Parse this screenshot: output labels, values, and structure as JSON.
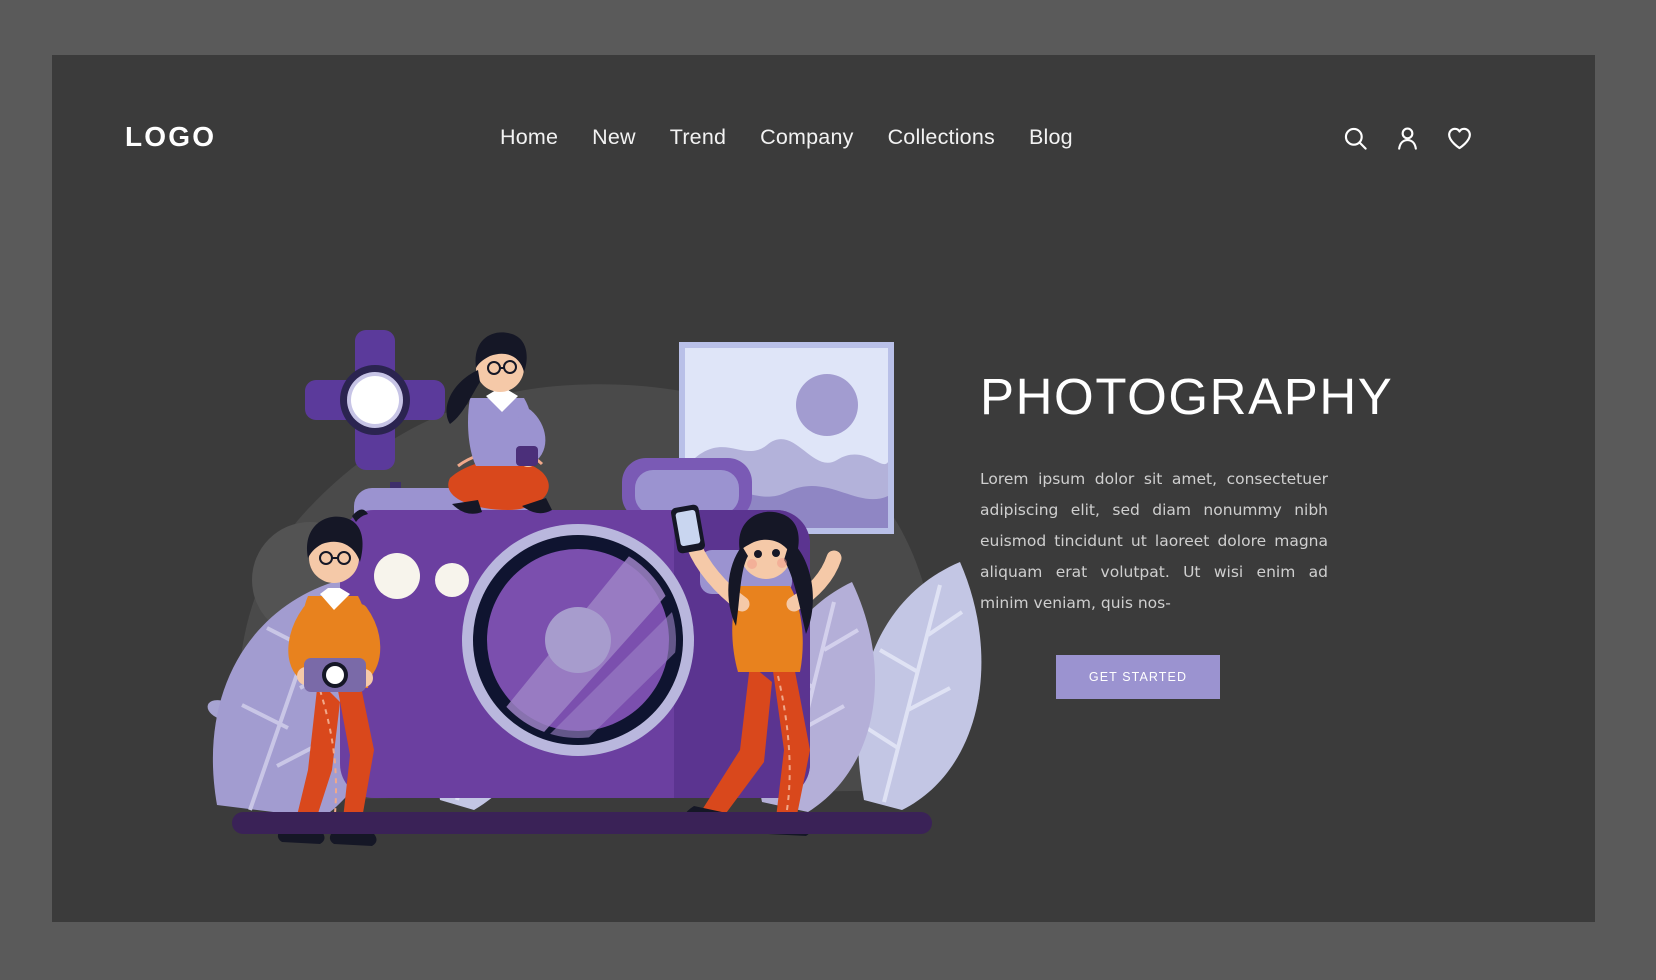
{
  "theme": {
    "outer_bg": "#5a5a5a",
    "panel_bg": "#3b3b3b",
    "accent_purple": "#6b3fa0",
    "button_bg": "#9b93d0",
    "text_white": "#ffffff",
    "text_muted": "#cfcfcf"
  },
  "navbar": {
    "logo": "LOGO",
    "links": [
      {
        "label": "Home"
      },
      {
        "label": "New"
      },
      {
        "label": "Trend"
      },
      {
        "label": "Company"
      },
      {
        "label": "Collections"
      },
      {
        "label": "Blog"
      }
    ],
    "icons": [
      {
        "name": "search-icon"
      },
      {
        "name": "user-icon"
      },
      {
        "name": "heart-icon"
      }
    ]
  },
  "hero": {
    "title": "PHOTOGRAPHY",
    "paragraph": "Lorem ipsum dolor sit amet, consectetuer adipiscing elit, sed diam nonummy nibh euismod tincidunt ut laoreet dolore magna aliquam erat volutpat. Ut wisi enim ad minim veniam, quis nos-",
    "cta_label": "GET STARTED"
  },
  "illustration": {
    "name": "photography-camera-scene",
    "elements": [
      "backdrop-blob",
      "studio-light",
      "framed-landscape-photo",
      "large-camera",
      "leaf-left",
      "leaf-right",
      "sprig-left",
      "sprig-right",
      "character-standing-left",
      "character-sitting-top",
      "character-selfie-right",
      "ground-bar"
    ],
    "colors": {
      "camera_body": "#6b3fa0",
      "camera_body_dark": "#5b3490",
      "camera_top": "#9b93d0",
      "lens_ring": "#b9b7dd",
      "lens_inner_dark": "#0f1430",
      "lens_glass": "#7b4fae",
      "lens_highlight": "#9d83c6",
      "leaf_light": "#c3c6e4",
      "leaf_dark": "#a29cd0",
      "frame_border": "#b9c0e8",
      "frame_fill": "#dfe5f8",
      "blob_gray": "#4a4a4a",
      "ground": "#3a2257",
      "skin": "#f5c9a8",
      "hair": "#151726",
      "shirt_orange": "#e8821e",
      "pants_red": "#d9481c",
      "shirt_lavender": "#9b93d0"
    }
  }
}
